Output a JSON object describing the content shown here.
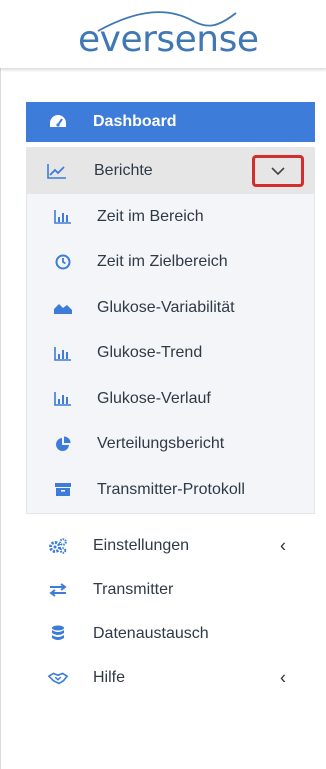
{
  "brand": {
    "name": "eversense",
    "color": "#3f78b5"
  },
  "nav": {
    "dashboard": {
      "label": "Dashboard",
      "icon": "gauge-icon"
    },
    "berichte": {
      "label": "Berichte",
      "icon": "line-chart-icon",
      "expanded": true,
      "items": [
        {
          "label": "Zeit im Bereich",
          "icon": "bar-chart-icon"
        },
        {
          "label": "Zeit im Zielbereich",
          "icon": "clock-icon"
        },
        {
          "label": "Glukose-Variabilität",
          "icon": "area-chart-icon"
        },
        {
          "label": "Glukose-Trend",
          "icon": "bar-chart-icon"
        },
        {
          "label": "Glukose-Verlauf",
          "icon": "bar-chart-icon"
        },
        {
          "label": "Verteilungsbericht",
          "icon": "pie-chart-icon"
        },
        {
          "label": "Transmitter-Protokoll",
          "icon": "archive-icon"
        }
      ]
    },
    "einstellungen": {
      "label": "Einstellungen",
      "icon": "cogs-icon"
    },
    "transmitter": {
      "label": "Transmitter",
      "icon": "exchange-icon"
    },
    "datenaustausch": {
      "label": "Datenaustausch",
      "icon": "database-icon"
    },
    "hilfe": {
      "label": "Hilfe",
      "icon": "handshake-icon"
    }
  },
  "colors": {
    "accent": "#3d7cd9",
    "icon_blue": "#3d7cd9",
    "highlight_red": "#d42d2d"
  }
}
